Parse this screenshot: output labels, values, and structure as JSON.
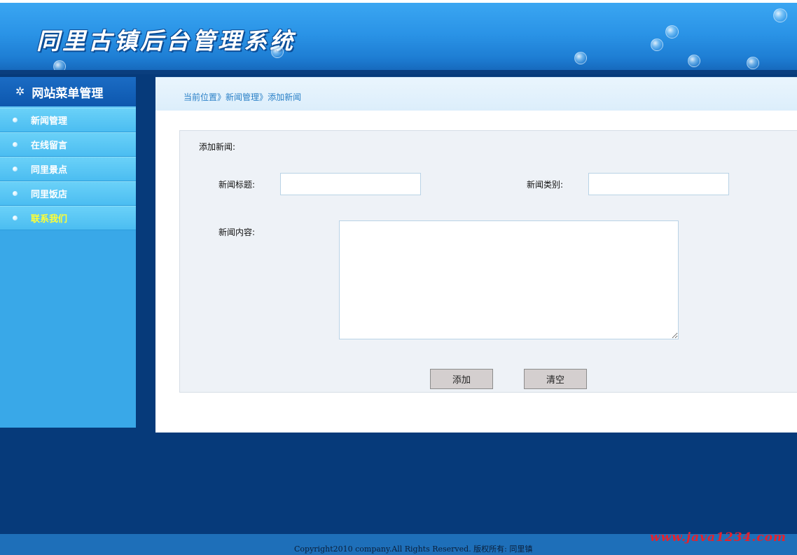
{
  "header": {
    "site_title": "同里古镇后台管理系统"
  },
  "sidebar": {
    "title": "网站菜单管理",
    "items": [
      {
        "label": "新闻管理"
      },
      {
        "label": "在线留言"
      },
      {
        "label": "同里景点"
      },
      {
        "label": "同里饭店"
      },
      {
        "label": "联系我们",
        "active": true
      }
    ]
  },
  "breadcrumb": {
    "current_label": "当前位置",
    "sep": "》",
    "level1": "新闻管理",
    "level2": "添加新闻"
  },
  "form": {
    "title": "添加新闻:",
    "news_title_label": "新闻标题:",
    "news_title_value": "",
    "news_category_label": "新闻类别:",
    "news_category_value": "",
    "news_content_label": "新闻内容:",
    "news_content_value": "",
    "add_button": "添加",
    "clear_button": "清空"
  },
  "footer": {
    "copyright": "Copyright2010 company.All Rights Reserved. 版权所有: 同里镇",
    "watermark": "www.java1234.com"
  },
  "colors": {
    "header_blue": "#2a93e6",
    "page_bg": "#063a7a",
    "sidebar_blue": "#39a8e8",
    "active_menu_text": "#ffff33",
    "breadcrumb_text": "#2a80c7",
    "watermark_red": "#e8202a"
  },
  "icons": {
    "sidebar_head": "gear-icon",
    "menu_bullet": "bullet-dot-icon"
  }
}
